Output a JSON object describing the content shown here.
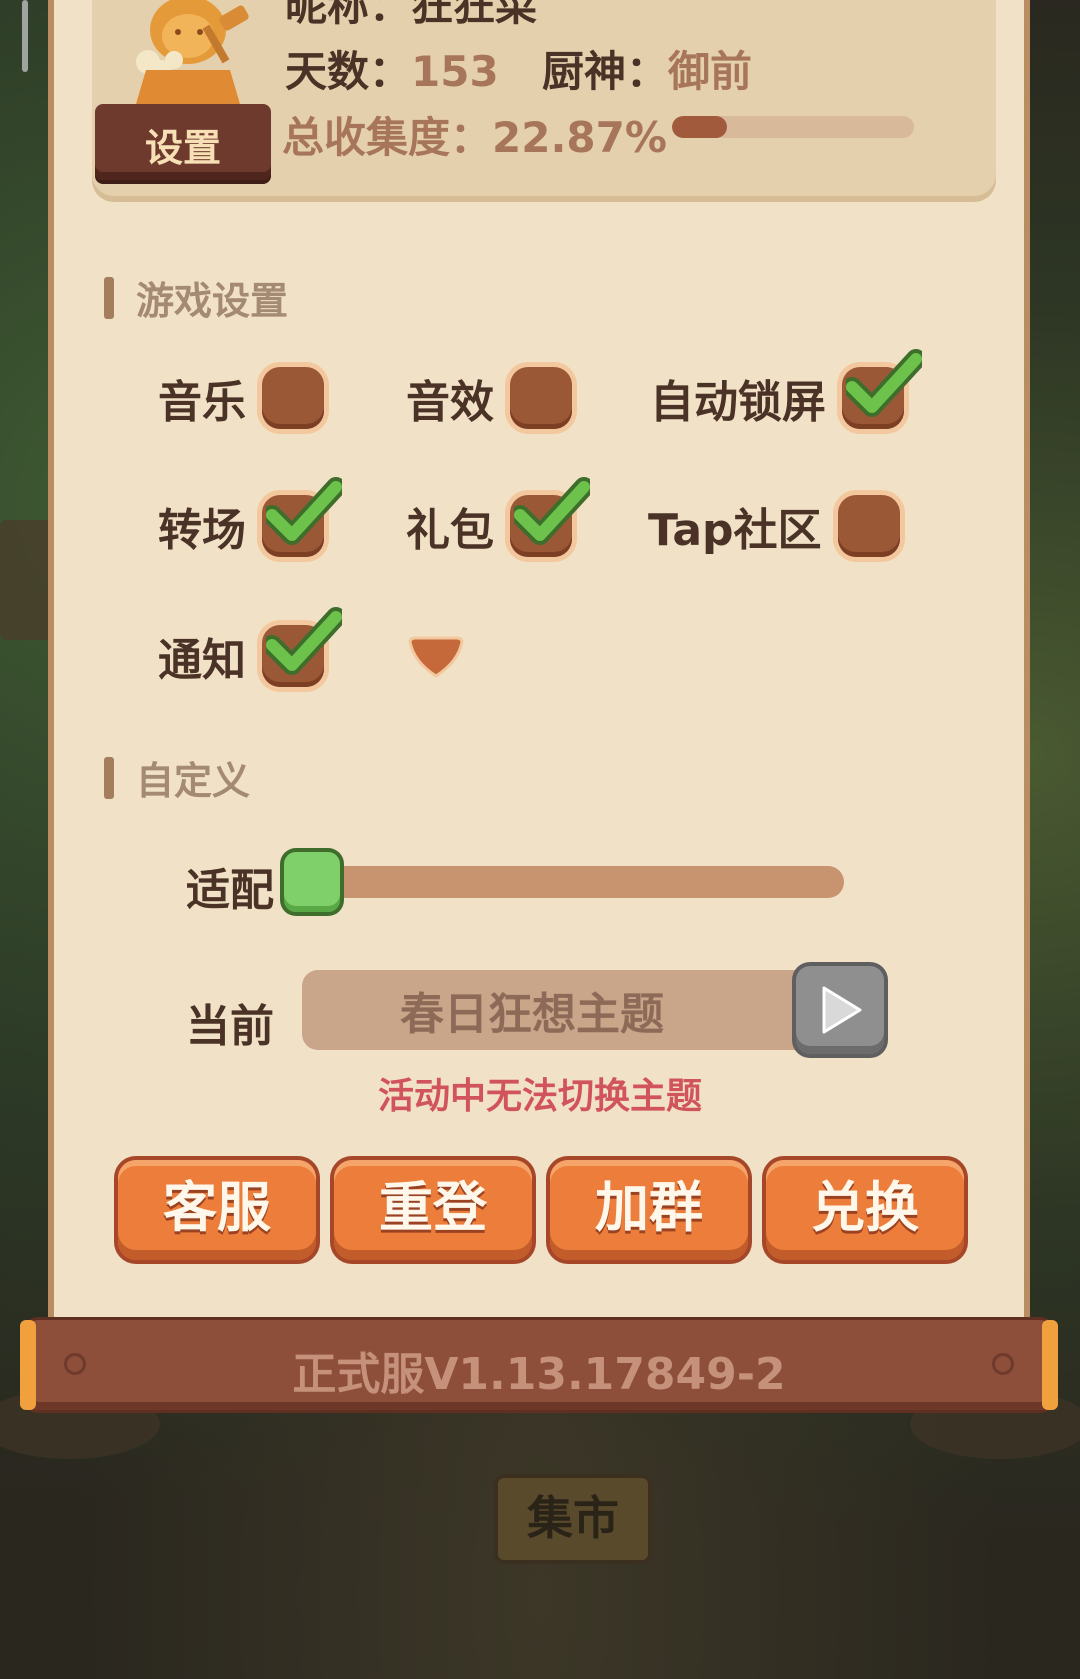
{
  "profile": {
    "name_partial": "昵称：狂狂菜",
    "settings_badge": "设置",
    "days_label": "天数：",
    "days_value": "153",
    "chef_label": "厨神：",
    "chef_value": "御前",
    "collect_label": "总收集度：",
    "collect_value": "22.87%",
    "collect_progress": 0.2287
  },
  "sections": {
    "game_settings": "游戏设置",
    "custom": "自定义"
  },
  "toggles": [
    {
      "label": "音乐",
      "checked": false
    },
    {
      "label": "音效",
      "checked": false
    },
    {
      "label": "自动锁屏",
      "checked": true
    },
    {
      "label": "转场",
      "checked": true
    },
    {
      "label": "礼包",
      "checked": true
    },
    {
      "label": "Tap社区",
      "checked": false
    },
    {
      "label": "通知",
      "checked": true
    }
  ],
  "custom": {
    "adapt_label": "适配",
    "adapt_value": 0,
    "current_label": "当前",
    "current_theme": "春日狂想主题",
    "theme_warning": "活动中无法切换主题"
  },
  "actions": [
    "客服",
    "重登",
    "加群",
    "兑换"
  ],
  "version": "正式服V1.13.17849-2",
  "market_sign": "集市",
  "colors": {
    "panel": "#f1e2c7",
    "checkbox": "#9b5837",
    "check_green": "#6cc24a",
    "action_orange": "#ec7d3b",
    "warning_red": "#d1545c"
  }
}
